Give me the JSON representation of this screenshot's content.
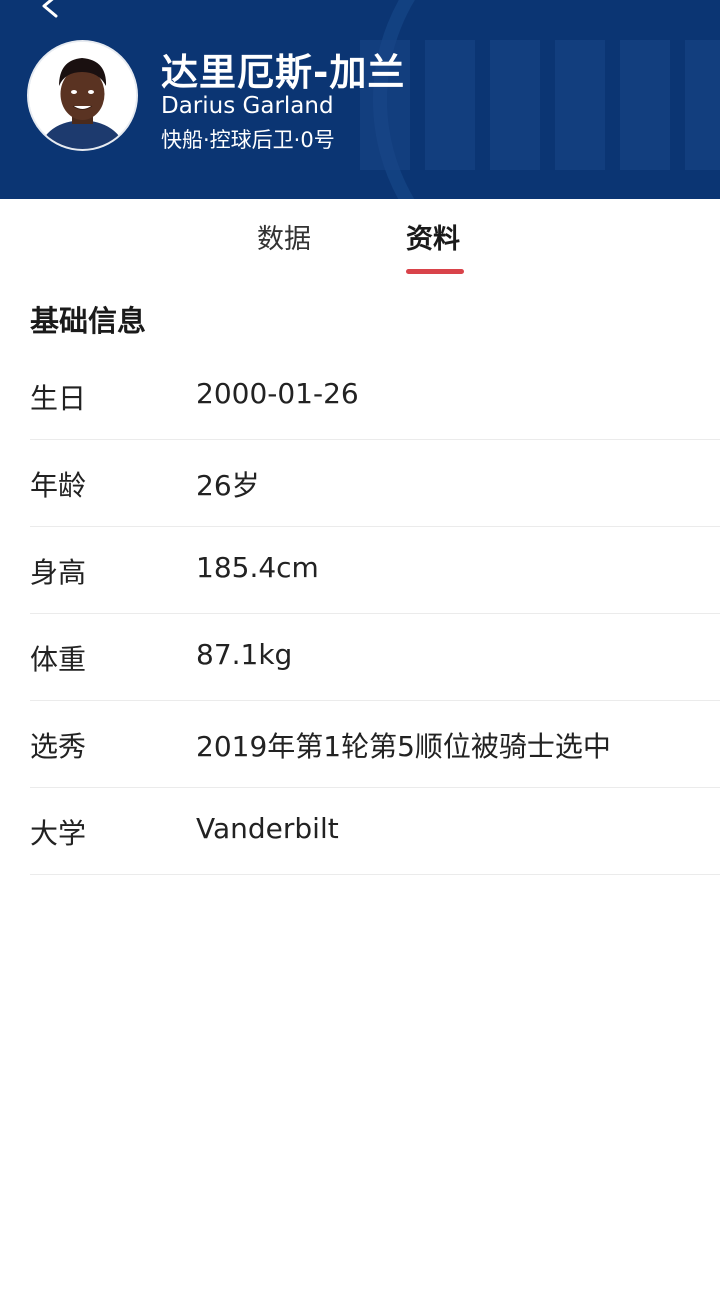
{
  "header": {
    "name_cn": "达里厄斯-加兰",
    "name_en": "Darius Garland",
    "team_info": "快船·控球后卫·0号",
    "background_color": "#0b3573"
  },
  "tabs": [
    {
      "label": "数据",
      "active": false
    },
    {
      "label": "资料",
      "active": true
    }
  ],
  "accent_color": "#d9434a",
  "section": {
    "title": "基础信息",
    "rows": [
      {
        "label": "生日",
        "value": "2000-01-26"
      },
      {
        "label": "年龄",
        "value": "26岁"
      },
      {
        "label": "身高",
        "value": "185.4cm"
      },
      {
        "label": "体重",
        "value": "87.1kg"
      },
      {
        "label": "选秀",
        "value": "2019年第1轮第5顺位被骑士选中"
      },
      {
        "label": "大学",
        "value": "Vanderbilt"
      }
    ]
  }
}
